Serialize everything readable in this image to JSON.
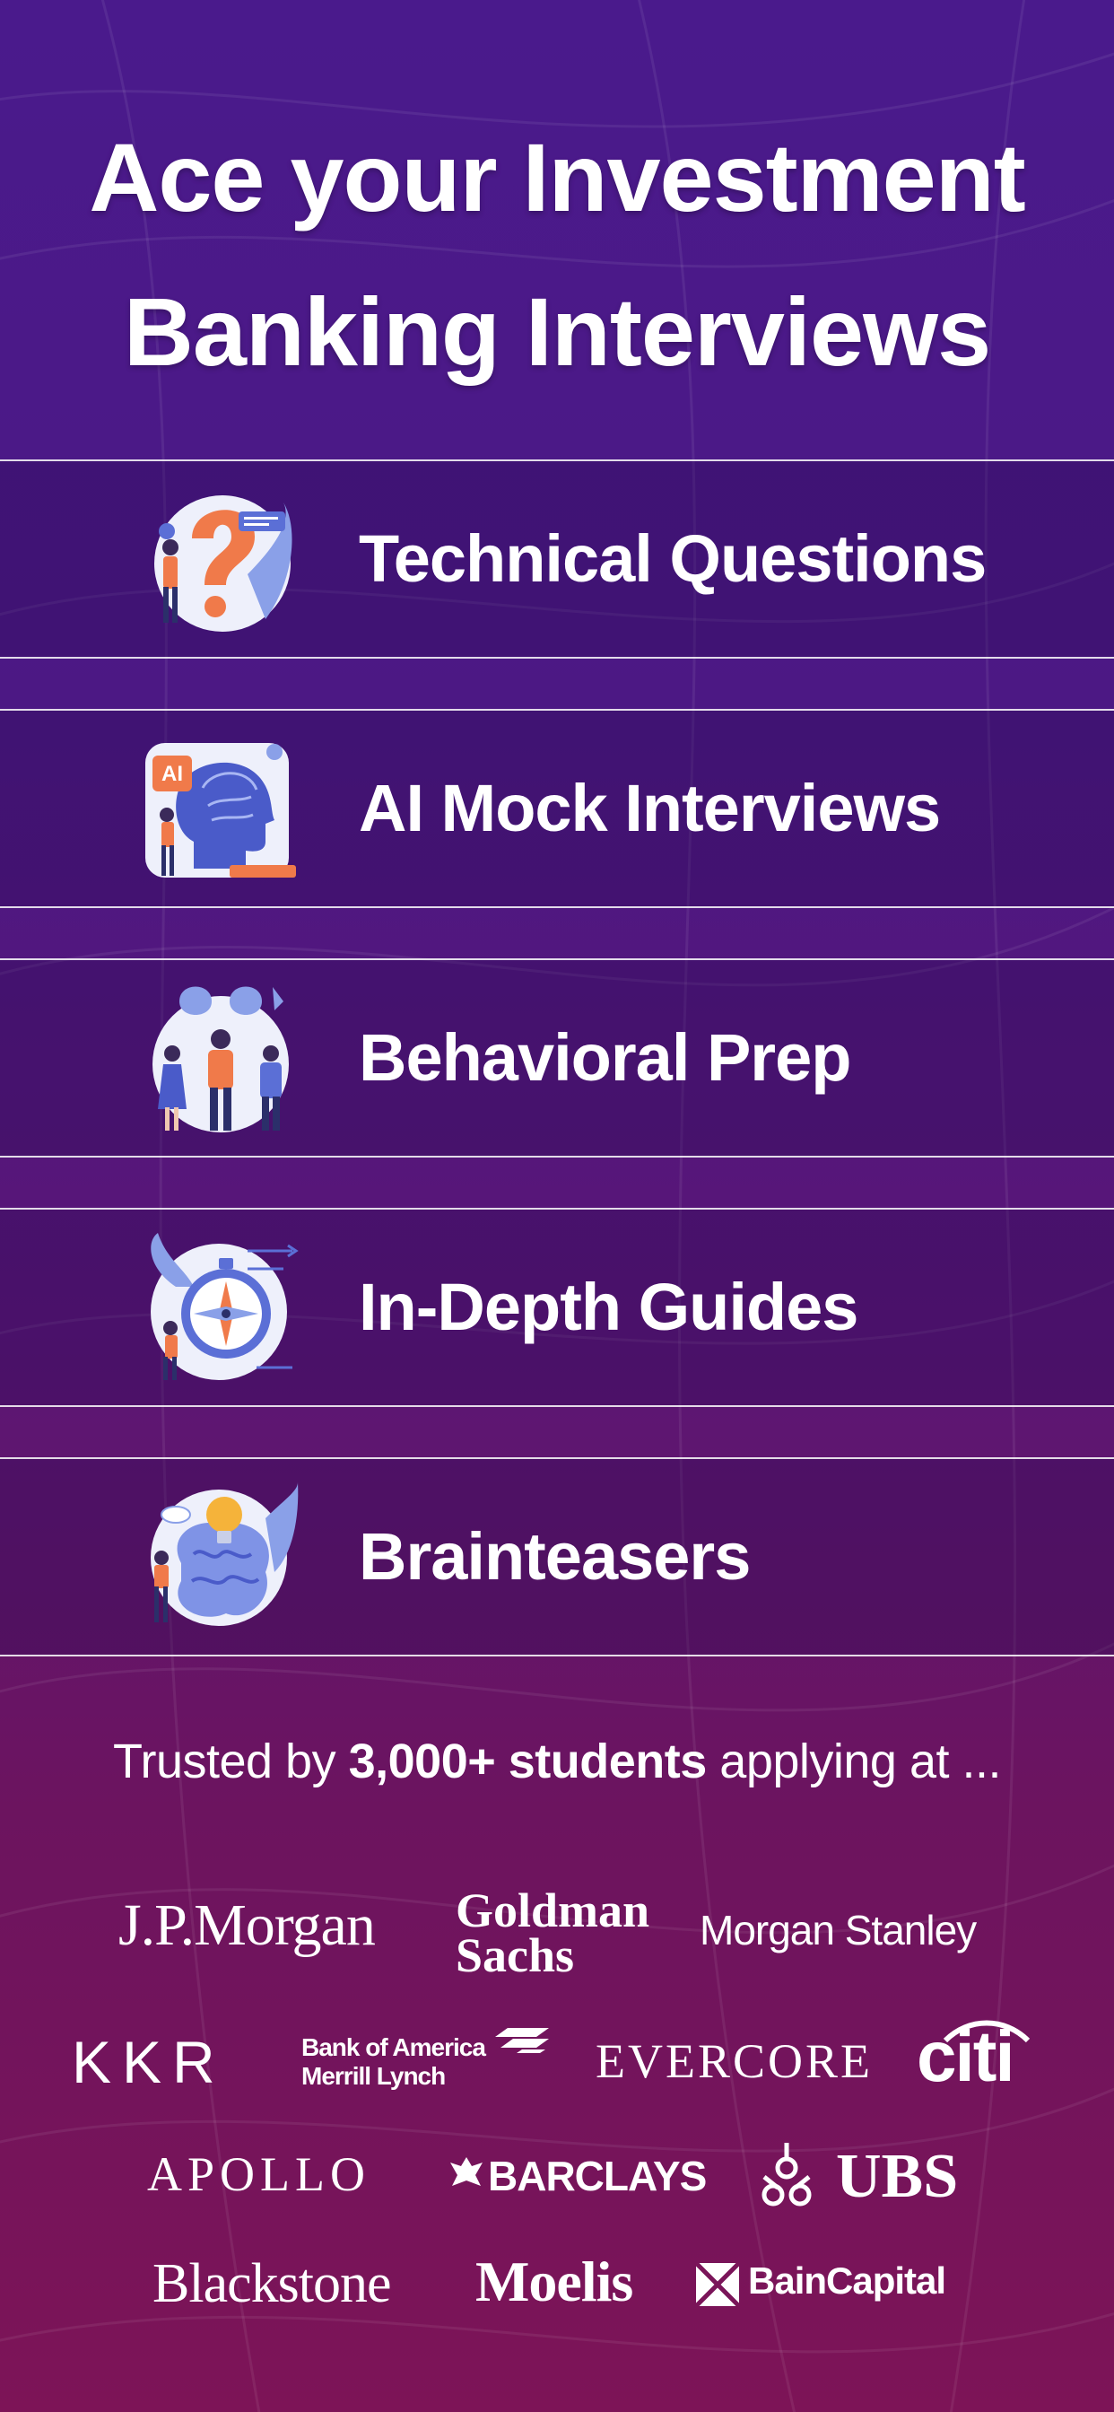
{
  "headline": {
    "line1": "Ace your Investment",
    "line2": "Banking Interviews"
  },
  "features": [
    {
      "label": "Technical Questions",
      "icon": "question-mark-illustration-icon"
    },
    {
      "label": "AI Mock Interviews",
      "icon": "ai-head-illustration-icon",
      "icon_text": "AI"
    },
    {
      "label": "Behavioral Prep",
      "icon": "people-masks-illustration-icon"
    },
    {
      "label": "In-Depth Guides",
      "icon": "compass-illustration-icon"
    },
    {
      "label": "Brainteasers",
      "icon": "brain-lightbulb-illustration-icon"
    }
  ],
  "trusted": {
    "prefix": "Trusted by ",
    "highlight": "3,000+ students",
    "suffix": " applying at ..."
  },
  "firms": {
    "jpmorgan": "J.P.Morgan",
    "goldman_line1": "Goldman",
    "goldman_line2": "Sachs",
    "morgan_stanley": "Morgan Stanley",
    "kkr": "KKR",
    "boa_line1": "Bank of America",
    "boa_line2": "Merrill Lynch",
    "evercore": "EVERCORE",
    "citi": "citi",
    "apollo": "APOLLO",
    "barclays": "BARCLAYS",
    "ubs": "UBS",
    "blackstone": "Blackstone",
    "moelis": "Moelis",
    "bain": "BainCapital"
  },
  "colors": {
    "background_top": "#4a1a8c",
    "background_bottom": "#7d1457",
    "text": "#ffffff",
    "accent_orange": "#f07a4a",
    "accent_blue": "#5b6fd6"
  }
}
